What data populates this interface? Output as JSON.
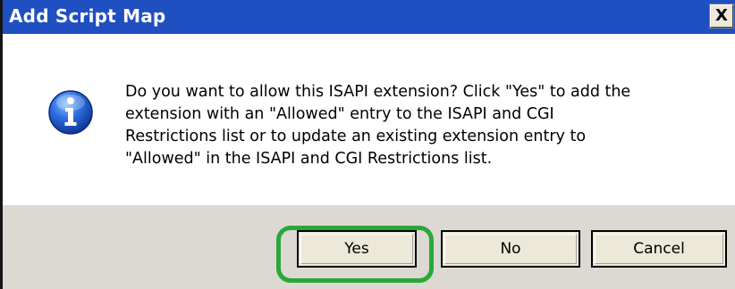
{
  "dialog": {
    "title": "Add Script Map",
    "close_label": "X"
  },
  "message": {
    "text": "Do you want to allow this ISAPI extension? Click \"Yes\" to add the extension with an \"Allowed\" entry to the ISAPI and CGI Restrictions list or to update an existing extension entry to \"Allowed\" in the ISAPI and CGI Restrictions list.",
    "lines": [
      "Do you want to allow this ISAPI extension? Click \"Yes\" to add the",
      "extension with an \"Allowed\" entry to the ISAPI and CGI",
      "Restrictions list or to update an existing extension entry to",
      "\"Allowed\" in the ISAPI and CGI Restrictions list."
    ],
    "icon": "information-icon"
  },
  "buttons": {
    "yes_label": "Yes",
    "no_label": "No",
    "cancel_label": "Cancel"
  },
  "colors": {
    "titlebar": "#1f4fc0",
    "button_bar": "#dcd9d3",
    "highlight": "#29a83a"
  }
}
